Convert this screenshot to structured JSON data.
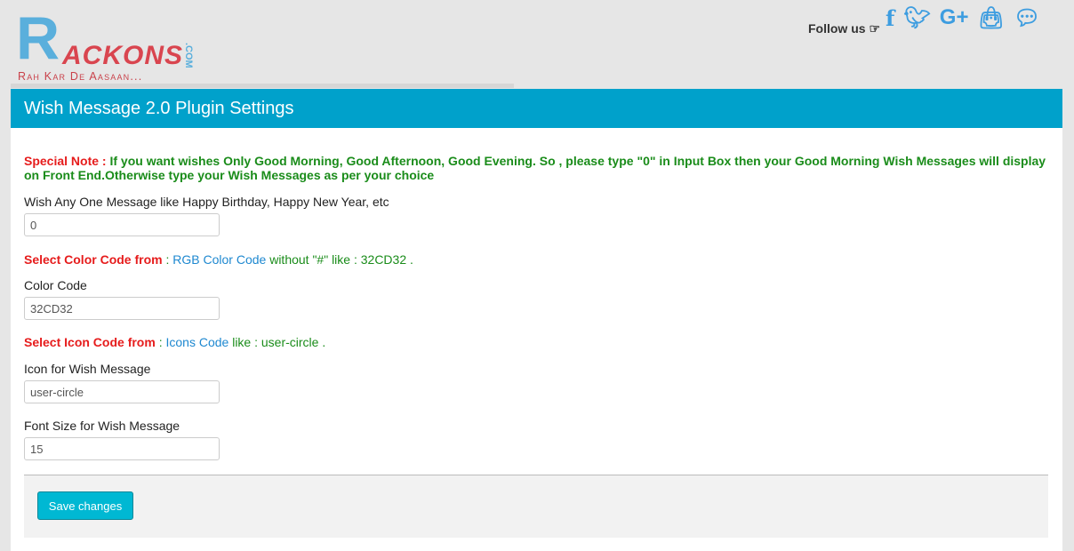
{
  "brand": {
    "logo_r": "R",
    "logo_text": "ACKONS",
    "logo_com": ".COM",
    "tagline": "Rah Kar De Aasaan..."
  },
  "follow": {
    "label": "Follow us ☞",
    "icons": [
      "facebook-icon",
      "twitter-icon",
      "google-plus-icon",
      "shopping-bag-icon",
      "comments-icon"
    ]
  },
  "panel": {
    "title": "Wish Message 2.0 Plugin Settings"
  },
  "note": {
    "prefix": "Special Note :",
    "text": " If you want wishes Only Good Morning, Good Afternoon, Good Evening. So , please type \"0\" in Input Box then your Good Morning Wish Messages will display on Front End.Otherwise type your Wish Messages as per your choice"
  },
  "fields": {
    "wish": {
      "label": "Wish Any One Message like Happy Birthday, Happy New Year, etc",
      "value": "0"
    },
    "color_hint": {
      "prefix": "Select Color Code from",
      "colon": " : ",
      "link": "RGB Color Code",
      "rest": " without \"#\" like : 32CD32 ."
    },
    "color": {
      "label": "Color Code",
      "value": "32CD32"
    },
    "icon_hint": {
      "prefix": "Select Icon Code from",
      "colon": " : ",
      "link": "Icons Code",
      "rest": " like : user-circle ."
    },
    "icon": {
      "label": "Icon for Wish Message",
      "value": "user-circle"
    },
    "font": {
      "label": "Font Size for Wish Message",
      "value": "15"
    }
  },
  "save_label": "Save changes"
}
